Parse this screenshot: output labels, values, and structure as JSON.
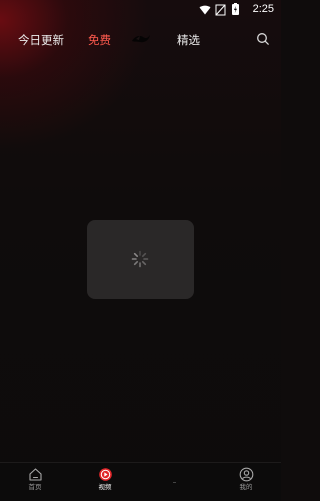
{
  "statusbar": {
    "time": "2:25"
  },
  "nav": {
    "tabs": [
      {
        "label": "今日更新"
      },
      {
        "label": "免费"
      },
      {
        "label": "精选"
      }
    ],
    "active_index": 1
  },
  "icons": {
    "search": "search-icon",
    "logo": "brand-logo-icon",
    "loading": "loading-spinner-icon",
    "home": "home-icon",
    "video": "play-icon",
    "profile": "user-icon"
  },
  "colors": {
    "accent": "#ff5a4e",
    "background": "#0f0c0c",
    "glow": "#7a0c12"
  },
  "bottom_tabs": [
    {
      "label": "首页"
    },
    {
      "label": "视频"
    },
    {
      "label": "我的"
    }
  ],
  "bottom_active_index": 1
}
